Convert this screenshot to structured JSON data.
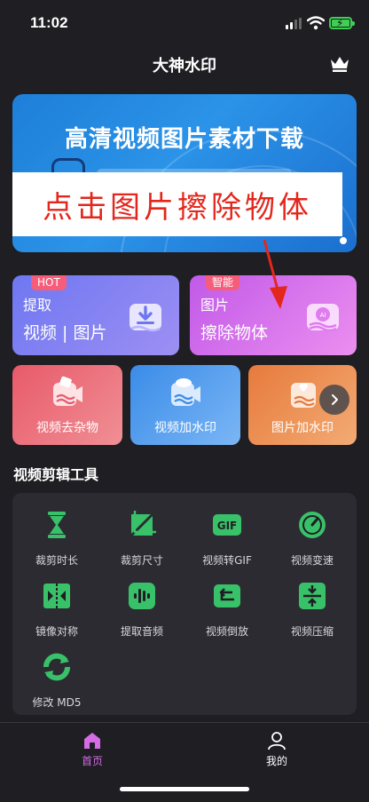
{
  "status": {
    "time": "11:02"
  },
  "nav": {
    "title": "大神水印",
    "crown_icon": "crown-icon"
  },
  "banner": {
    "title": "高清视频图片素材下载",
    "overlay_text": "点击图片擦除物体"
  },
  "features": {
    "extract": {
      "tag": "HOT",
      "label_1": "提取",
      "label_2": "视频 | 图片",
      "icon": "download-icon"
    },
    "erase": {
      "tag": "智能",
      "label_1": "图片",
      "label_2": "擦除物体",
      "icon": "ai-erase-icon"
    }
  },
  "quick_tools": [
    {
      "label": "视频去杂物",
      "icon": "video-denoise-icon"
    },
    {
      "label": "视频加水印",
      "icon": "video-watermark-icon"
    },
    {
      "label": "图片加水印",
      "icon": "image-watermark-icon"
    }
  ],
  "section": {
    "title": "视频剪辑工具"
  },
  "tools": [
    {
      "label": "裁剪时长",
      "icon": "hourglass-icon"
    },
    {
      "label": "裁剪尺寸",
      "icon": "crop-icon"
    },
    {
      "label": "视频转GIF",
      "icon": "gif-icon"
    },
    {
      "label": "视频变速",
      "icon": "speed-icon"
    },
    {
      "label": "镜像对称",
      "icon": "mirror-icon"
    },
    {
      "label": "提取音频",
      "icon": "audio-icon"
    },
    {
      "label": "视频倒放",
      "icon": "reverse-icon"
    },
    {
      "label": "视频压缩",
      "icon": "compress-icon"
    },
    {
      "label": "修改 MD5",
      "icon": "refresh-icon"
    }
  ],
  "tabs": [
    {
      "label": "首页",
      "icon": "home-icon"
    },
    {
      "label": "我的",
      "icon": "user-icon"
    }
  ],
  "colors": {
    "accent": "#d66be6",
    "tool_green": "#39c16a",
    "background": "#1e1e23"
  }
}
